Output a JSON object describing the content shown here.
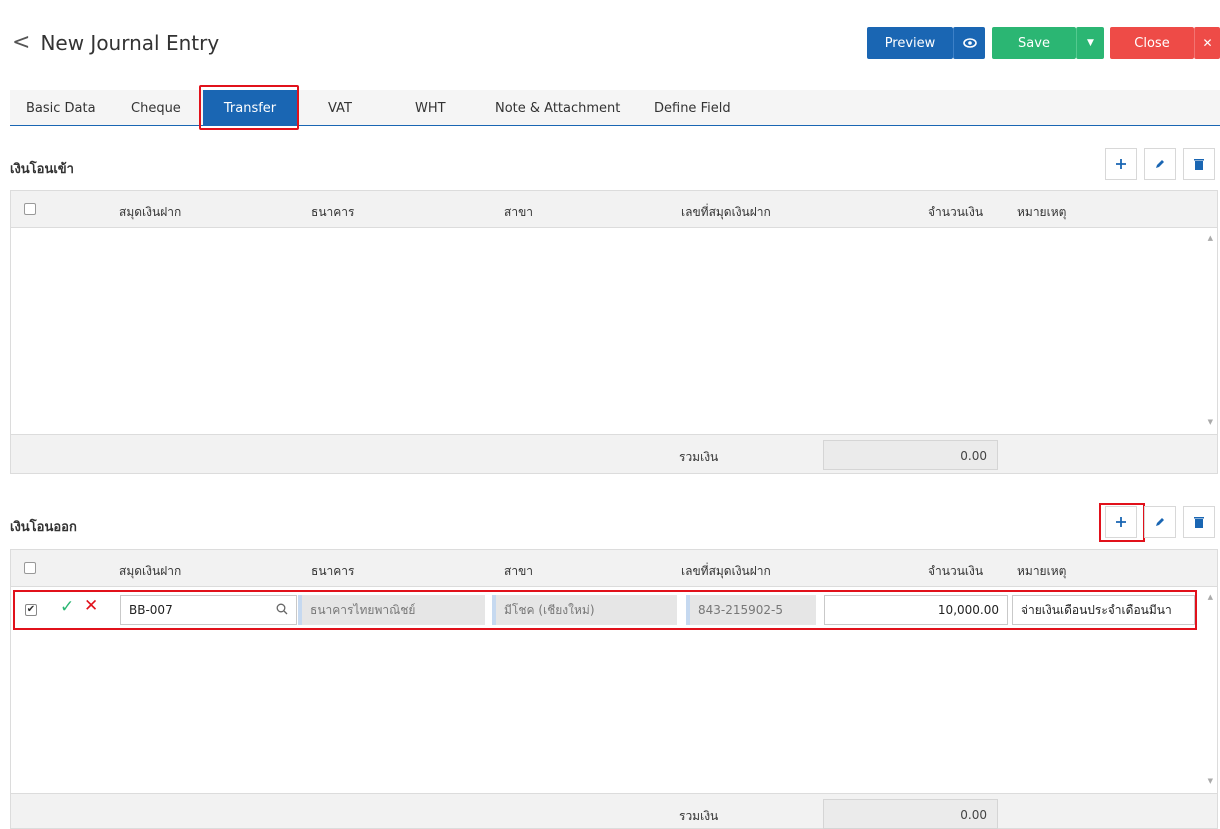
{
  "header": {
    "back_icon": "chevron-left-icon",
    "title": "New Journal Entry",
    "preview_label": "Preview",
    "save_label": "Save",
    "close_label": "Close"
  },
  "tabs": [
    {
      "label": "Basic Data"
    },
    {
      "label": "Cheque"
    },
    {
      "label": "Transfer",
      "active": true
    },
    {
      "label": "VAT"
    },
    {
      "label": "WHT"
    },
    {
      "label": "Note & Attachment"
    },
    {
      "label": "Define Field"
    }
  ],
  "columns": {
    "book": "สมุดเงินฝาก",
    "bank": "ธนาคาร",
    "branch": "สาขา",
    "account_no": "เลขที่สมุดเงินฝาก",
    "amount": "จำนวนเงิน",
    "note": "หมายเหตุ"
  },
  "transfer_in": {
    "title": "เงินโอนเข้า",
    "total_label": "รวมเงิน",
    "total_value": "0.00"
  },
  "transfer_out": {
    "title": "เงินโอนออก",
    "total_label": "รวมเงิน",
    "total_value": "0.00",
    "row": {
      "book": "BB-007",
      "bank": "ธนาคารไทยพาณิชย์",
      "branch": "มีโชค (เชียงใหม่)",
      "account_no": "843-215902-5",
      "amount": "10,000.00",
      "note": "จ่ายเงินเดือนประจำเดือนมีนา"
    }
  },
  "colors": {
    "primary": "#1a66b3",
    "save": "#2bb673",
    "close": "#ee4b47",
    "highlight": "#e1111b"
  }
}
